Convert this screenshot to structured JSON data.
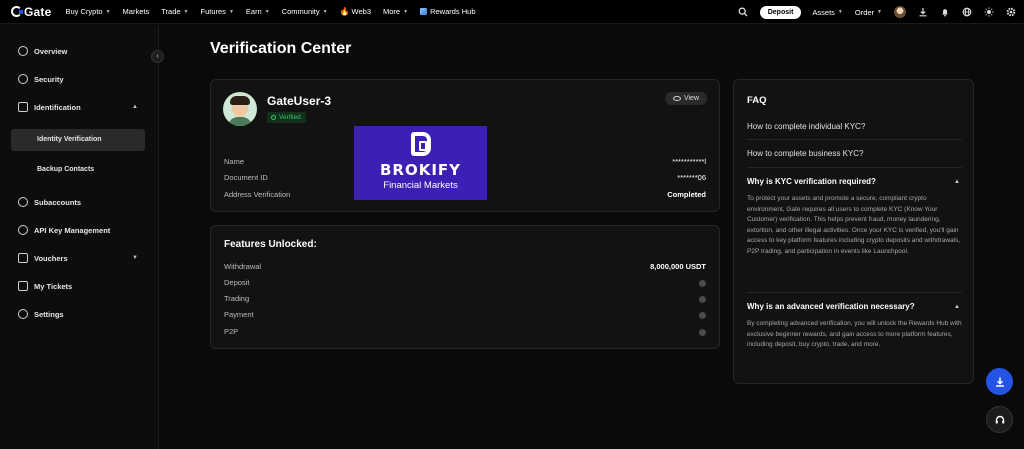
{
  "nav": {
    "logo": "Gate",
    "items": [
      {
        "label": "Buy Crypto",
        "caret": true
      },
      {
        "label": "Markets",
        "caret": false
      },
      {
        "label": "Trade",
        "caret": true
      },
      {
        "label": "Futures",
        "caret": true
      },
      {
        "label": "Earn",
        "caret": true
      },
      {
        "label": "Community",
        "caret": true
      },
      {
        "label": "Web3",
        "caret": false
      },
      {
        "label": "More",
        "caret": true
      },
      {
        "label": "Rewards Hub",
        "caret": false
      }
    ],
    "deposit": "Deposit",
    "assets": "Assets",
    "order": "Order"
  },
  "sidebar": {
    "overview": "Overview",
    "security": "Security",
    "identification": "Identification",
    "identity_verification": "Identity Verification",
    "backup_contacts": "Backup Contacts",
    "subaccounts": "Subaccounts",
    "api_key_management": "API Key Management",
    "vouchers": "Vouchers",
    "my_tickets": "My Tickets",
    "settings": "Settings"
  },
  "page": {
    "title": "Verification Center"
  },
  "user": {
    "name": "GateUser-3",
    "status": "Verified",
    "view_label": "View",
    "rows": [
      {
        "label": "Name",
        "value": "***********l"
      },
      {
        "label": "Document ID",
        "value": "*******06"
      },
      {
        "label": "Address Verification",
        "value": "Completed"
      }
    ]
  },
  "features": {
    "title": "Features Unlocked:",
    "rows": [
      {
        "label": "Withdrawal",
        "value": "8,000,000 USDT"
      },
      {
        "label": "Deposit",
        "value": ""
      },
      {
        "label": "Trading",
        "value": ""
      },
      {
        "label": "Payment",
        "value": ""
      },
      {
        "label": "P2P",
        "value": ""
      }
    ]
  },
  "faq": {
    "title": "FAQ",
    "q1": "How to complete individual KYC?",
    "q2": "How to complete business KYC?",
    "q3": "Why is KYC verification required?",
    "a3": "To protect your assets and promote a secure, compliant crypto environment, Gate requires all users to complete KYC (Know Your Customer) verification. This helps prevent fraud, money laundering, extortion, and other illegal activities. Once your KYC is verified, you'll gain access to key platform features including crypto deposits and withdrawals, P2P trading, and participation in events like Launchpool.",
    "q4": "Why is an advanced verification necessary?",
    "a4": "By completing advanced verification, you will unlock the Rewards Hub with exclusive beginner rewards, and gain access to more platform features, including deposit, buy crypto, trade, and more."
  },
  "overlay": {
    "brand": "BROKIFY",
    "subtitle": "Financial Markets"
  },
  "colors": {
    "accent_blue": "#2354e6",
    "verified_green": "#2ecc71",
    "overlay_purple": "#3d1fb5"
  }
}
